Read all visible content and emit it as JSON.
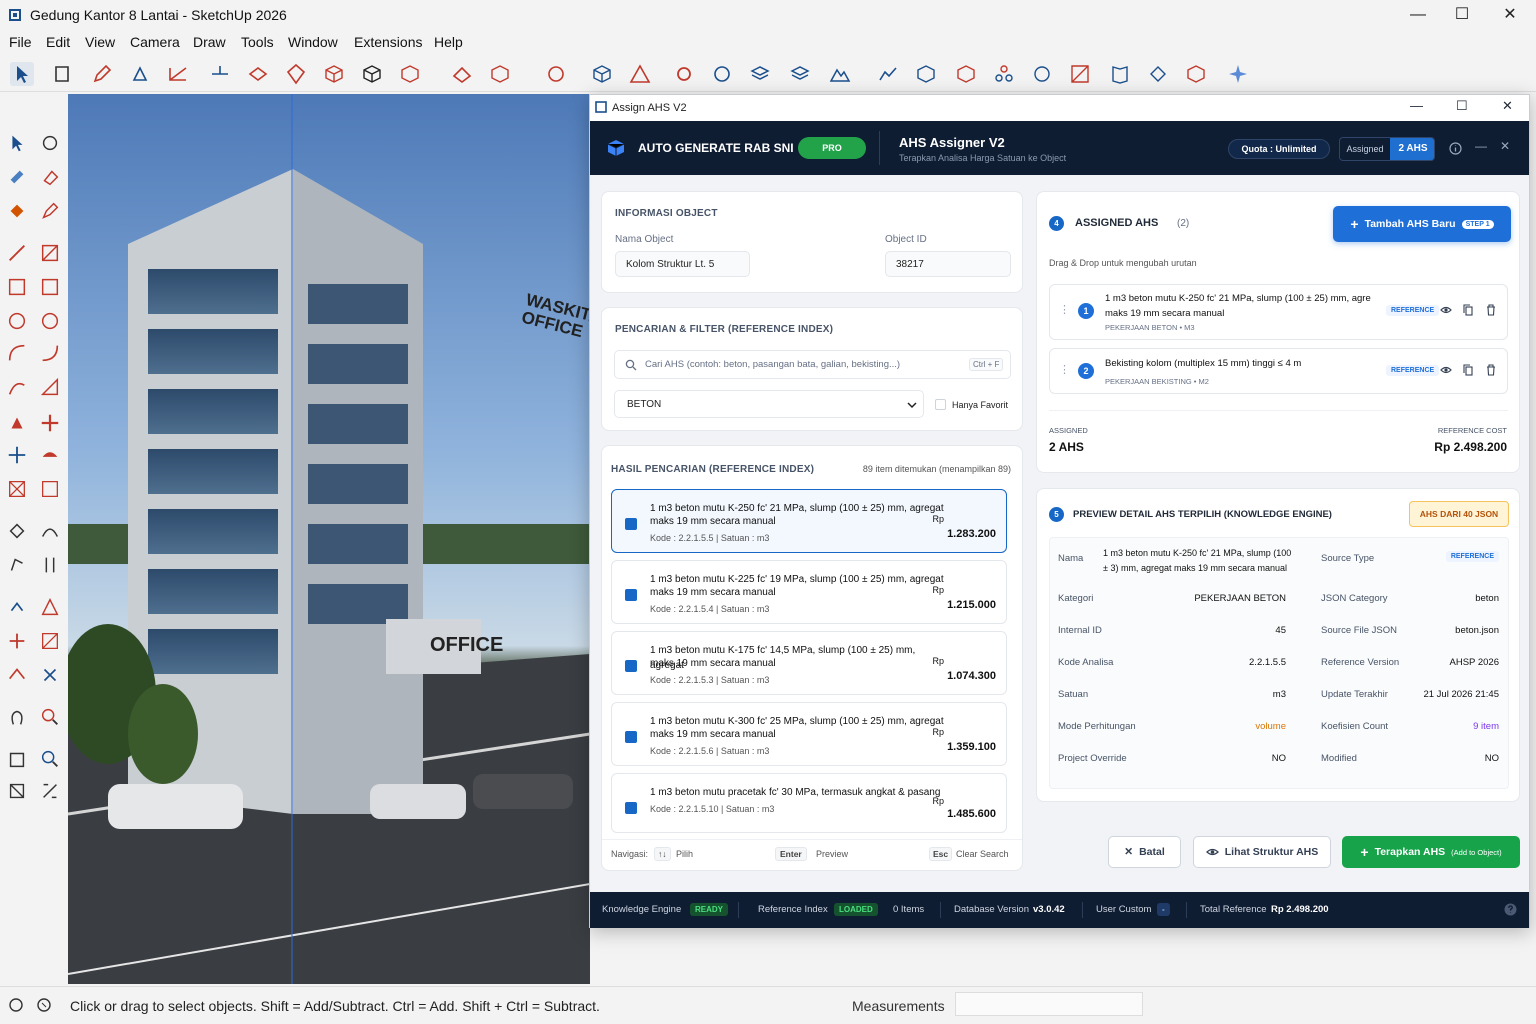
{
  "window": {
    "title": "Gedung Kantor 8 Lantai - SketchUp 2026",
    "minimize": "—",
    "maximize": "☐",
    "close": "✕"
  },
  "menu": [
    "File",
    "Edit",
    "View",
    "Camera",
    "Draw",
    "Tools",
    "Window",
    "Extensions",
    "Help"
  ],
  "building": {
    "sign_top": "WASKITA OFFICE",
    "sign_entrance": "OFFICE"
  },
  "status": {
    "hint": "Click or drag to select objects. Shift = Add/Subtract. Ctrl = Add. Shift + Ctrl = Subtract.",
    "measurements_label": "Measurements",
    "measurements_value": ""
  },
  "dialog": {
    "title": "Assign AHS V2",
    "header": {
      "brand": "AUTO GENERATE RAB SNI",
      "pro_badge": "PRO",
      "app_title": "AHS Assigner V2",
      "app_subtitle": "Terapkan Analisa Harga Satuan ke Object",
      "quota": "Quota : Unlimited",
      "assigned_label": "Assigned",
      "assigned_count": "2 AHS"
    },
    "info": {
      "section": "INFORMASI OBJECT",
      "name_label": "Nama Object",
      "name_value": "Kolom Struktur Lt. 5",
      "id_label": "Object ID",
      "id_value": "38217"
    },
    "search": {
      "section": "PENCARIAN & FILTER (REFERENCE INDEX)",
      "placeholder": "Cari AHS (contoh: beton, pasangan bata, galian, bekisting...)",
      "shortcut": "Ctrl + F",
      "category": "BETON",
      "favorite_label": "Hanya Favorit"
    },
    "results": {
      "section": "HASIL PENCARIAN (REFERENCE INDEX)",
      "count_text": "89 item ditemukan (menampilkan 89)",
      "items": [
        {
          "line1": "1 m3 beton mutu K-250 fc' 21 MPa, slump (100 ± 25) mm, agregat",
          "line2": "maks 19 mm secara manual",
          "code": "Kode : 2.2.1.5.5 | Satuan : m3",
          "rp": "Rp",
          "price": "1.283.200"
        },
        {
          "line1": "1 m3 beton mutu K-225 fc' 19 MPa, slump (100 ± 25) mm, agregat",
          "line2": "maks 19 mm secara manual",
          "code": "Kode : 2.2.1.5.4 | Satuan : m3",
          "rp": "Rp",
          "price": "1.215.000"
        },
        {
          "line1": "1 m3 beton mutu K-175 fc' 14,5 MPa, slump (100 ± 25) mm, agregat",
          "line2": "maks 19 mm secara manual",
          "code": "Kode : 2.2.1.5.3 | Satuan : m3",
          "rp": "Rp",
          "price": "1.074.300"
        },
        {
          "line1": "1 m3 beton mutu K-300 fc' 25 MPa, slump (100 ± 25) mm, agregat",
          "line2": "maks 19 mm secara manual",
          "code": "Kode : 2.2.1.5.6 | Satuan : m3",
          "rp": "Rp",
          "price": "1.359.100"
        },
        {
          "line1": "1 m3 beton mutu pracetak fc' 30 MPa, termasuk angkat & pasang",
          "line2": "",
          "code": "Kode : 2.2.1.5.10 | Satuan : m3",
          "rp": "Rp",
          "price": "1.485.600"
        }
      ],
      "nav_label": "Navigasi:",
      "nav_key1": "↑↓",
      "nav_act1": "Pilih",
      "nav_key2": "Enter",
      "nav_act2": "Preview",
      "nav_key3": "Esc",
      "nav_act3": "Clear Search"
    },
    "assigned": {
      "step": "4",
      "section": "ASSIGNED AHS",
      "count": "(2)",
      "add_button": "Tambah AHS Baru",
      "add_badge": "STEP 1",
      "hint": "Drag & Drop untuk mengubah urutan",
      "items": [
        {
          "num": "1",
          "line1": "1 m3 beton mutu K-250 fc' 21 MPa, slump (100 ± 25) mm, agre",
          "line2": "maks 19 mm secara manual",
          "sub": "PEKERJAAN BETON • M3",
          "tag": "REFERENCE"
        },
        {
          "num": "2",
          "line1": "Bekisting kolom (multiplex 15 mm) tinggi ≤ 4 m",
          "line2": "",
          "sub": "PEKERJAAN BEKISTING • M2",
          "tag": "REFERENCE"
        }
      ],
      "total_label": "ASSIGNED",
      "total_value": "2 AHS",
      "cost_label": "REFERENCE COST",
      "cost_value": "Rp 2.498.200"
    },
    "preview": {
      "step": "5",
      "section": "PREVIEW DETAIL AHS TERPILIH (KNOWLEDGE ENGINE)",
      "badge": "AHS DARI 40 JSON",
      "left": [
        {
          "k": "Nama",
          "v": "1 m3 beton mutu K-250 fc' 21 MPa, slump (100 ± 3) mm, agregat maks 19 mm secara manual"
        },
        {
          "k": "Kategori",
          "v": "PEKERJAAN BETON"
        },
        {
          "k": "Internal ID",
          "v": "45"
        },
        {
          "k": "Kode Analisa",
          "v": "2.2.1.5.5"
        },
        {
          "k": "Satuan",
          "v": "m3"
        },
        {
          "k": "Mode Perhitungan",
          "v": "volume"
        },
        {
          "k": "Project Override",
          "v": "NO"
        }
      ],
      "right": [
        {
          "k": "Source Type",
          "v": "REFERENCE"
        },
        {
          "k": "JSON Category",
          "v": "beton"
        },
        {
          "k": "Source File JSON",
          "v": "beton.json"
        },
        {
          "k": "Reference Version",
          "v": "AHSP 2026"
        },
        {
          "k": "Update Terakhir",
          "v": "21 Jul 2026 21:45"
        },
        {
          "k": "Koefisien Count",
          "v": "9 item"
        },
        {
          "k": "Modified",
          "v": "NO"
        }
      ]
    },
    "actions": {
      "cancel": "Batal",
      "view": "Lihat Struktur AHS",
      "apply": "Terapkan AHS",
      "apply_sub": "(Add to Object)"
    },
    "footer": {
      "ke_label": "Knowledge Engine",
      "ke_status": "READY",
      "ri_label": "Reference Index",
      "ri_status": "LOADED",
      "ri_items": "0 Items",
      "db_label": "Database Version",
      "db_value": "v3.0.42",
      "uc_label": "User Custom",
      "uc_value": "-",
      "tr_label": "Total Reference",
      "tr_value": "Rp 2.498.200"
    }
  },
  "colors": {
    "accent": "#1767c6",
    "green": "#16a34a",
    "navy": "#0f1d33",
    "orange": "#d97706",
    "purple": "#7c3aed"
  }
}
